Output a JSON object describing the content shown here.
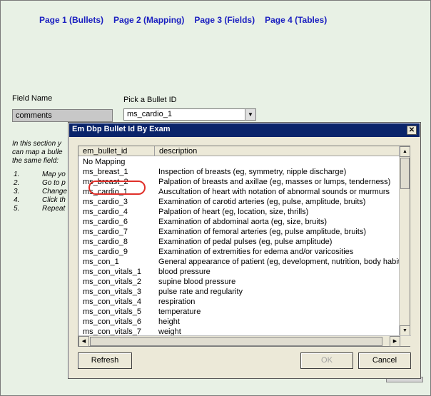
{
  "nav": [
    "Page 1 (Bullets)",
    "Page 2 (Mapping)",
    "Page 3 (Fields)",
    "Page 4 (Tables)"
  ],
  "form": {
    "field_name_label": "Field Name",
    "field_name_value": "comments",
    "bullet_label": "Pick a Bullet ID",
    "bullet_value": "ms_cardio_1"
  },
  "instructions": {
    "line1": "In this section y",
    "line2": "can map a bulle",
    "line3": "the same field:",
    "steps": [
      {
        "n": "1.",
        "t": "Map yo"
      },
      {
        "n": "2.",
        "t": "Go to p"
      },
      {
        "n": "3.",
        "t": "Change"
      },
      {
        "n": "4.",
        "t": "Click th"
      },
      {
        "n": "5.",
        "t": "Repeat"
      }
    ]
  },
  "dialog": {
    "title": "Em Dbp Bullet Id By Exam",
    "close": "✕",
    "col1": "em_bullet_id",
    "col2": "description",
    "rows": [
      {
        "id": "No Mapping",
        "desc": ""
      },
      {
        "id": "ms_breast_1",
        "desc": "Inspection of breasts (eg, symmetry, nipple discharge)"
      },
      {
        "id": "ms_breast_2",
        "desc": "Palpation of breasts and axillae (eg, masses or lumps, tenderness)"
      },
      {
        "id": "ms_cardio_1",
        "desc": "Auscultation of heart with notation of abnormal sounds or murmurs"
      },
      {
        "id": "ms_cardio_3",
        "desc": "Examination of carotid arteries  (eg, pulse, amplitude, bruits)"
      },
      {
        "id": "ms_cardio_4",
        "desc": "Palpation of heart (eg, location, size, thrills)"
      },
      {
        "id": "ms_cardio_6",
        "desc": "Examination of abdominal aorta (eg, size, bruits)"
      },
      {
        "id": "ms_cardio_7",
        "desc": "Examination of femoral arteries (eg, pulse amplitude, bruits)"
      },
      {
        "id": "ms_cardio_8",
        "desc": "Examination of pedal pulses (eg, pulse amplitude)"
      },
      {
        "id": "ms_cardio_9",
        "desc": "Examination of extremities for edema and/or varicosities"
      },
      {
        "id": "ms_con_1",
        "desc": "General appearance of patient (eg, development, nutrition, body habitus"
      },
      {
        "id": "ms_con_vitals_1",
        "desc": "blood pressure"
      },
      {
        "id": "ms_con_vitals_2",
        "desc": "supine blood pressure"
      },
      {
        "id": "ms_con_vitals_3",
        "desc": "pulse rate and regularity"
      },
      {
        "id": "ms_con_vitals_4",
        "desc": "respiration"
      },
      {
        "id": "ms_con_vitals_5",
        "desc": "temperature"
      },
      {
        "id": "ms_con_vitals_6",
        "desc": "height"
      },
      {
        "id": "ms_con_vitals_7",
        "desc": "weight"
      }
    ],
    "refresh": "Refresh",
    "ok": "OK",
    "cancel": "Cancel"
  }
}
